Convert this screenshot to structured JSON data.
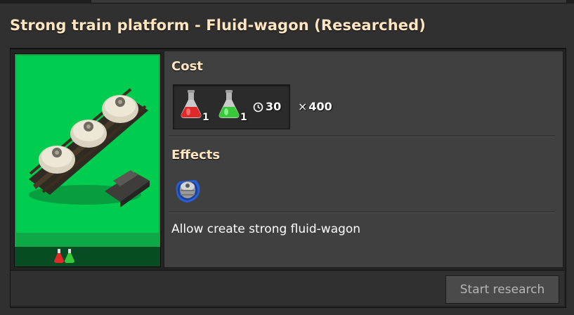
{
  "window": {
    "title": "Strong train platform - Fluid-wagon (Researched)"
  },
  "technology": {
    "icon": "fluid-wagon-icon",
    "tile_color": "#00cc4f",
    "science_packs": [
      "automation-science-pack-icon",
      "logistic-science-pack-icon"
    ]
  },
  "cost": {
    "heading": "Cost",
    "ingredients": [
      {
        "icon": "automation-science-pack-icon",
        "color": "#e02a2a",
        "amount": "1"
      },
      {
        "icon": "logistic-science-pack-icon",
        "color": "#37c937",
        "amount": "1"
      }
    ],
    "time": "30",
    "time_icon": "clock-icon",
    "multiplier_symbol": "×",
    "multiplier": "400"
  },
  "effects": {
    "heading": "Effects",
    "items": [
      {
        "icon": "storage-tank-icon",
        "text": "Allow create strong fluid-wagon"
      }
    ]
  },
  "actions": {
    "start_research": "Start research"
  }
}
